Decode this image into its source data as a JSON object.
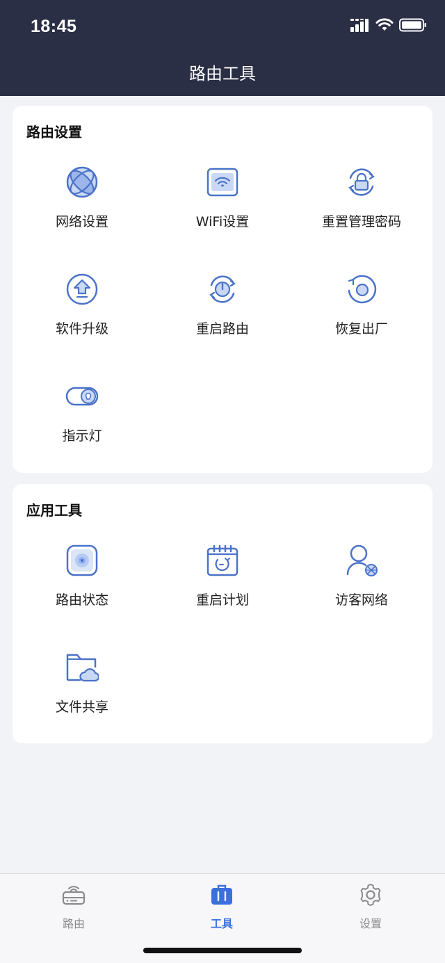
{
  "status_bar": {
    "time": "18:45"
  },
  "header": {
    "title": "路由工具"
  },
  "sections": [
    {
      "title": "路由设置",
      "items": [
        {
          "label": "网络设置",
          "icon": "globe-icon"
        },
        {
          "label": "WiFi设置",
          "icon": "wifi-router-icon"
        },
        {
          "label": "重置管理密码",
          "icon": "lock-reset-icon"
        },
        {
          "label": "软件升级",
          "icon": "upgrade-arrow-icon"
        },
        {
          "label": "重启路由",
          "icon": "restart-power-icon"
        },
        {
          "label": "恢复出厂",
          "icon": "factory-reset-icon"
        },
        {
          "label": "指示灯",
          "icon": "indicator-light-toggle-icon"
        }
      ]
    },
    {
      "title": "应用工具",
      "items": [
        {
          "label": "路由状态",
          "icon": "router-status-icon"
        },
        {
          "label": "重启计划",
          "icon": "restart-schedule-calendar-icon"
        },
        {
          "label": "访客网络",
          "icon": "guest-network-user-icon"
        },
        {
          "label": "文件共享",
          "icon": "file-share-cloud-folder-icon"
        }
      ]
    }
  ],
  "tabbar": {
    "tabs": [
      {
        "label": "路由",
        "icon": "router-icon",
        "active": false
      },
      {
        "label": "工具",
        "icon": "toolbox-icon",
        "active": true
      },
      {
        "label": "设置",
        "icon": "gear-icon",
        "active": false
      }
    ]
  },
  "colors": {
    "accent": "#3b6fe0",
    "icon_stroke": "#4a72c9",
    "icon_fill": "#c9d8f5",
    "header_bg": "#2b2f45"
  }
}
